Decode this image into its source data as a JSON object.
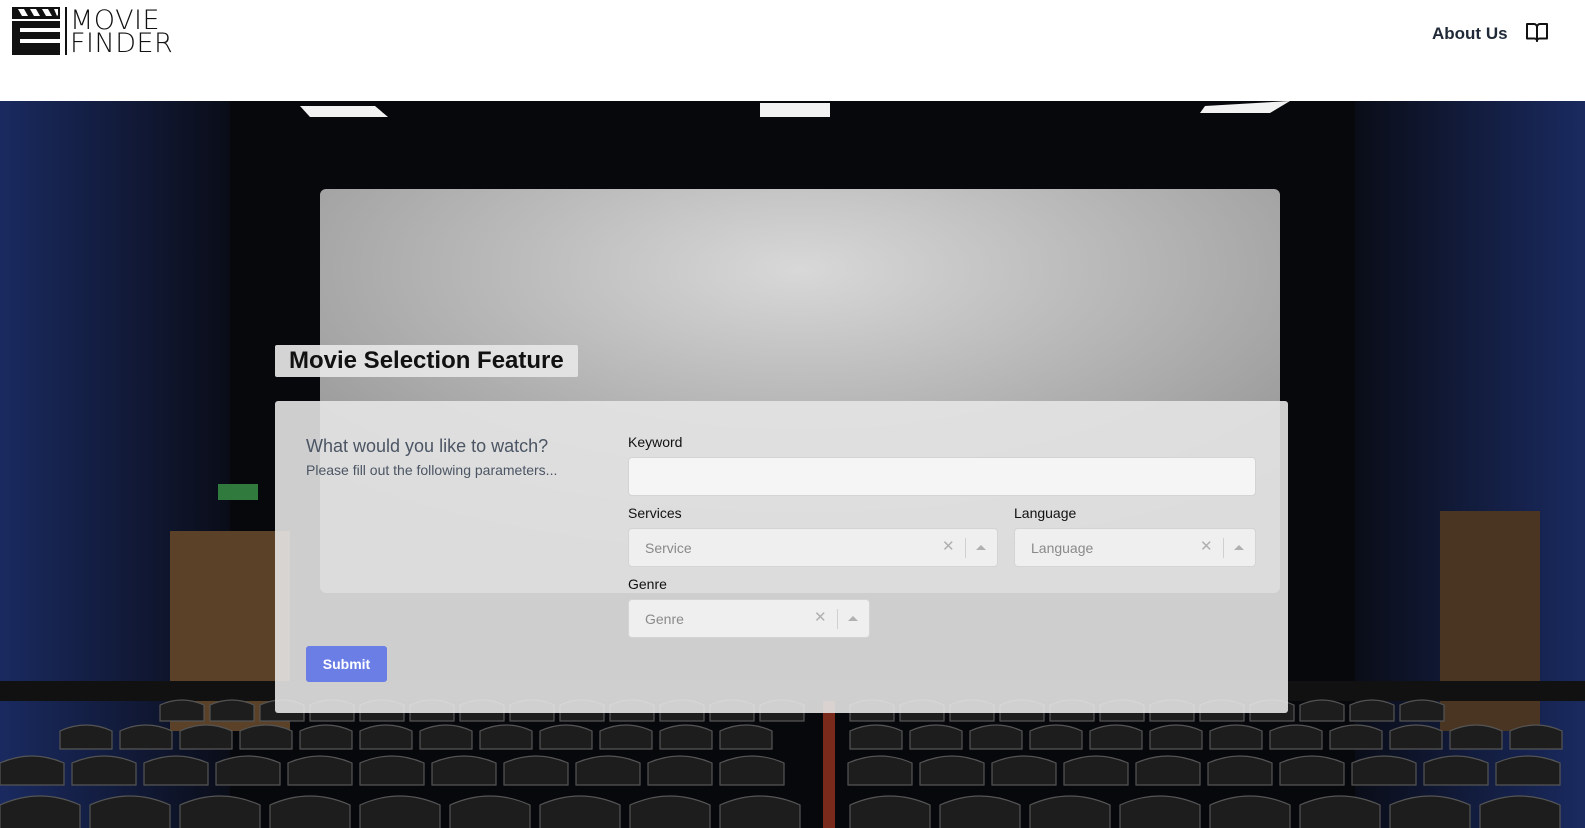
{
  "header": {
    "logo_line1": "MOVIE",
    "logo_line2": "FINDER",
    "about_label": "About Us"
  },
  "main": {
    "title": "Movie Selection Feature",
    "intro_heading": "What would you like to watch?",
    "intro_text": "Please fill out the following parameters...",
    "submit_label": "Submit"
  },
  "form": {
    "keyword": {
      "label": "Keyword",
      "value": "",
      "placeholder": ""
    },
    "services": {
      "label": "Services",
      "placeholder": "Service"
    },
    "language": {
      "label": "Language",
      "placeholder": "Language"
    },
    "genre": {
      "label": "Genre",
      "placeholder": "Genre"
    }
  },
  "icons": {
    "logo": "clapperboard-icon",
    "docs": "book-icon",
    "clear": "close-icon",
    "dropdown": "chevron-up-icon"
  },
  "colors": {
    "accent": "#6b7ee6",
    "panel": "#e4e4e4",
    "text": "#1f2937"
  }
}
